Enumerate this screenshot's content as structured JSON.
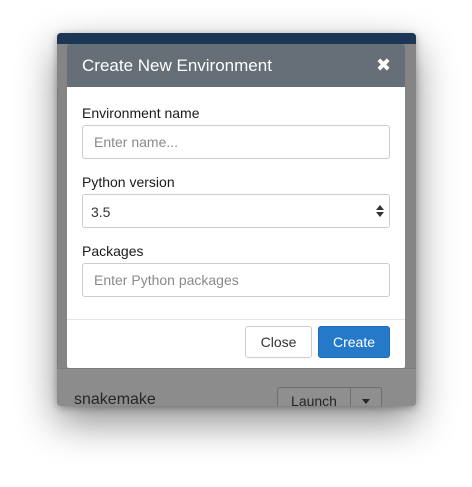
{
  "background": {
    "row_title": "snakemake",
    "launch_label": "Launch"
  },
  "modal": {
    "title": "Create New Environment",
    "close_icon": "close-x-icon",
    "fields": {
      "name": {
        "label": "Environment name",
        "placeholder": "Enter name...",
        "value": ""
      },
      "python": {
        "label": "Python version",
        "value": "3.5"
      },
      "packages": {
        "label": "Packages",
        "placeholder": "Enter Python packages",
        "value": ""
      }
    },
    "buttons": {
      "close": "Close",
      "create": "Create"
    }
  },
  "colors": {
    "header_bg": "#666e77",
    "primary": "#2479c8",
    "background_dim": "#858585",
    "app_topbar": "#1d3656"
  }
}
